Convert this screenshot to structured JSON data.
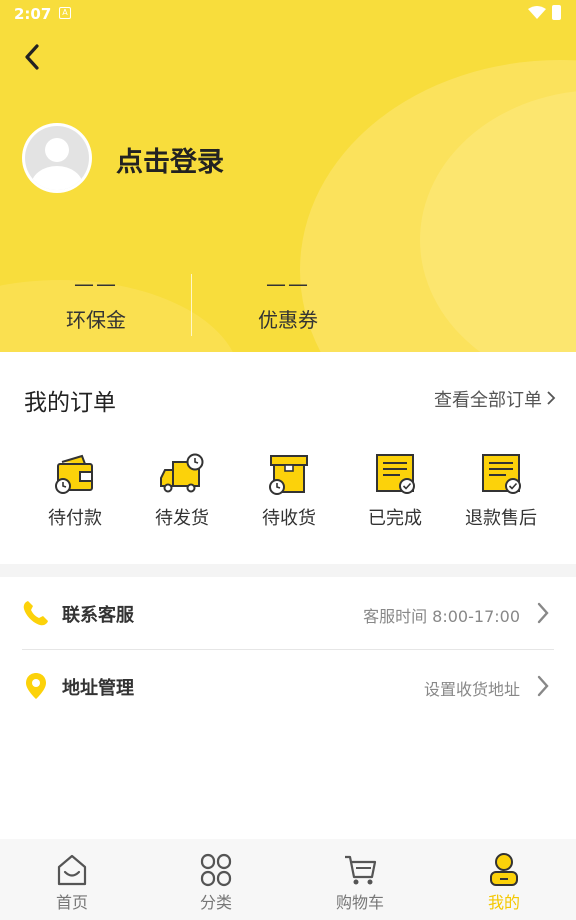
{
  "status_bar": {
    "time": "2:07",
    "notification_glyph": "A"
  },
  "profile": {
    "login_text": "点击登录"
  },
  "stats": [
    {
      "value": "——",
      "label": "环保金"
    },
    {
      "value": "——",
      "label": "优惠券"
    }
  ],
  "orders": {
    "title": "我的订单",
    "view_all": "查看全部订单",
    "items": [
      {
        "label": "待付款",
        "icon": "wallet-clock-icon"
      },
      {
        "label": "待发货",
        "icon": "truck-clock-icon"
      },
      {
        "label": "待收货",
        "icon": "box-clock-icon"
      },
      {
        "label": "已完成",
        "icon": "receipt-check-icon"
      },
      {
        "label": "退款售后",
        "icon": "receipt-refund-icon"
      }
    ]
  },
  "menu": {
    "service": {
      "title": "联系客服",
      "subtitle": "客服时间 8:00-17:00",
      "icon": "phone-icon"
    },
    "address": {
      "title": "地址管理",
      "subtitle": "设置收货地址",
      "icon": "location-pin-icon"
    }
  },
  "tabbar": {
    "items": [
      {
        "label": "首页",
        "icon": "home-icon"
      },
      {
        "label": "分类",
        "icon": "category-icon"
      },
      {
        "label": "购物车",
        "icon": "cart-icon"
      },
      {
        "label": "我的",
        "icon": "profile-icon",
        "active": true
      }
    ]
  },
  "colors": {
    "accent": "#f8dd3c",
    "active_tab": "#f4c800",
    "icon_yellow": "#fcd20a"
  }
}
